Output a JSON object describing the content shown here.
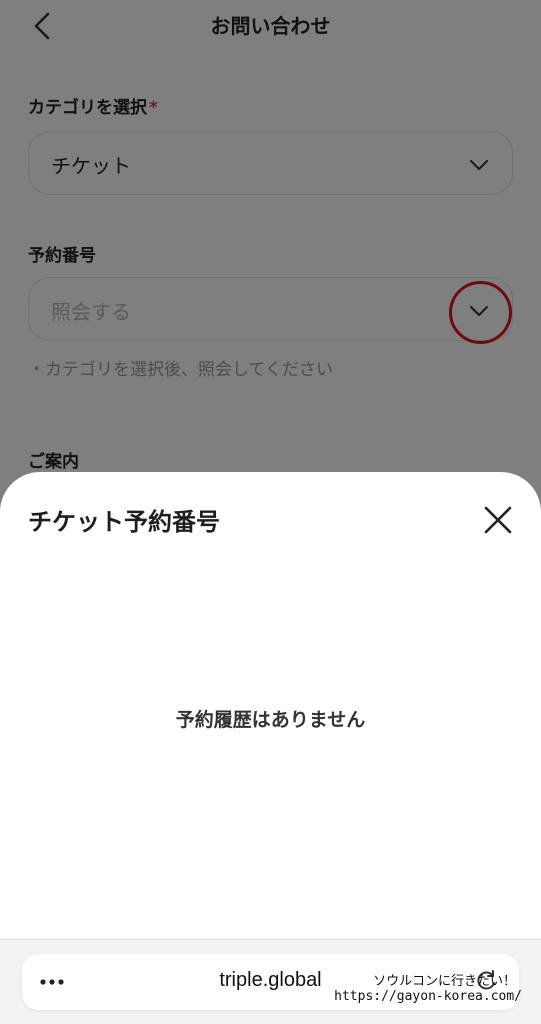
{
  "header": {
    "title": "お問い合わせ"
  },
  "category": {
    "label": "カテゴリを選択",
    "required_mark": "*",
    "value": "チケット"
  },
  "reservation": {
    "label": "予約番号",
    "placeholder": "照会する",
    "hint": "・カテゴリを選択後、照会してください"
  },
  "guide": {
    "label": "ご案内"
  },
  "sheet": {
    "title": "チケット予約番号",
    "empty_message": "予約履歴はありません"
  },
  "browser": {
    "more_label": "•••",
    "url": "triple.global"
  },
  "watermark": {
    "line1": "ソウルコンに行きたい！",
    "line2": "https://gayon-korea.com/"
  },
  "colors": {
    "required": "#e53935",
    "annotation_circle": "#e0141e",
    "overlay": "rgba(0,0,0,0.5)"
  }
}
